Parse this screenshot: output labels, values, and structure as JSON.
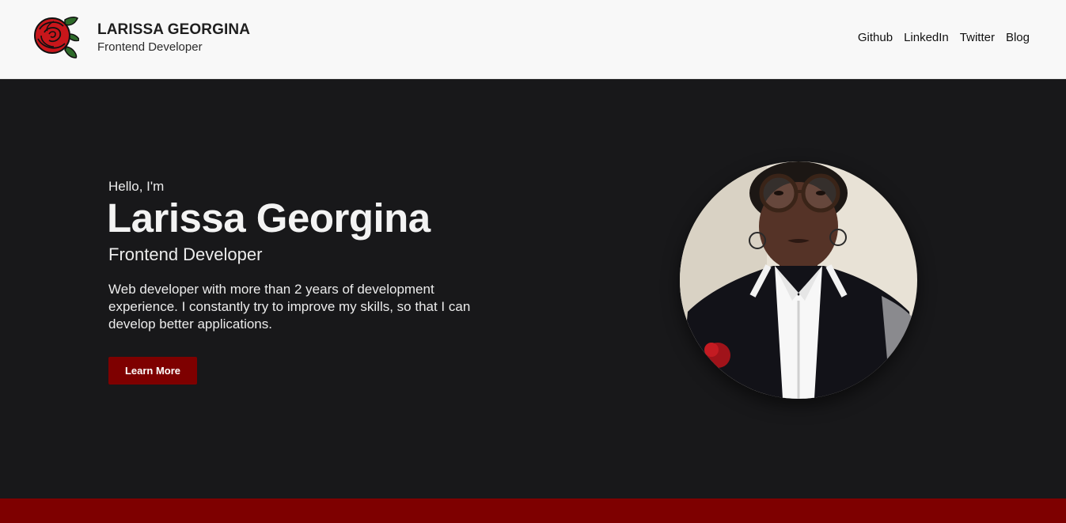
{
  "brand": {
    "name": "LARISSA GEORGINA",
    "role": "Frontend Developer",
    "logo_icon": "rose-icon"
  },
  "nav": {
    "items": [
      {
        "label": "Github"
      },
      {
        "label": "LinkedIn"
      },
      {
        "label": "Twitter"
      },
      {
        "label": "Blog"
      }
    ]
  },
  "hero": {
    "greeting": "Hello, I'm",
    "name": "Larissa Georgina",
    "role": "Frontend Developer",
    "description": "Web developer with more than 2 years of development experience. I constantly try to improve my skills, so that I can develop better applications.",
    "cta_label": "Learn More",
    "portrait_icon": "profile-photo"
  },
  "colors": {
    "accent": "#7e0000",
    "hero_background": "#18181a",
    "header_background": "#f8f8f8"
  }
}
